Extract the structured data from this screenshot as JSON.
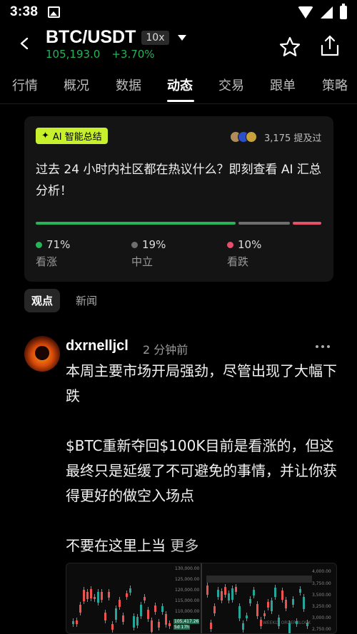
{
  "status": {
    "time": "3:38"
  },
  "header": {
    "pair": "BTC/USDT",
    "leverage": "10x",
    "price": "105,193.0",
    "change": "+3.70%"
  },
  "tabs": [
    "行情",
    "概况",
    "数据",
    "动态",
    "交易",
    "跟单",
    "策略"
  ],
  "active_tab": "动态",
  "ai_card": {
    "badge": "AI 智能总结",
    "mention_count": "3,175 提及过",
    "text": "过去 24 小时内社区都在热议什么？即刻查看 AI 汇总分析！",
    "sentiment": [
      {
        "pct": "71%",
        "label": "看涨",
        "color": "#26b35a",
        "fraction": 0.71
      },
      {
        "pct": "19%",
        "label": "中立",
        "color": "#6e6e6e",
        "fraction": 0.19
      },
      {
        "pct": "10%",
        "label": "看跌",
        "color": "#e5506b",
        "fraction": 0.1
      }
    ]
  },
  "subtabs": [
    "观点",
    "新闻"
  ],
  "post": {
    "user": "dxrnelljcl",
    "time": "2 分钟前",
    "p1": "本周主要市场开局强劲，尽管出现了大幅下跌",
    "p2": "$BTC重新夺回$100K目前是看涨的，但这最终只是延缓了不可避免的事情，并让你获得更好的做空入场点",
    "p3": " 不要在这里上当",
    "more": "更多",
    "image": {
      "left_axis": [
        "130,000.00",
        "125,000.00",
        "120,000.00",
        "115,000.00",
        "110,000.00",
        "105,417.26",
        "5d 17h"
      ],
      "right_axis": [
        "4,000.00",
        "3,750.00",
        "3,500.00",
        "3,250.00",
        "3,000.00",
        "2,750.00"
      ],
      "watermark": "WEEKLY ORDERBLOCK"
    }
  }
}
